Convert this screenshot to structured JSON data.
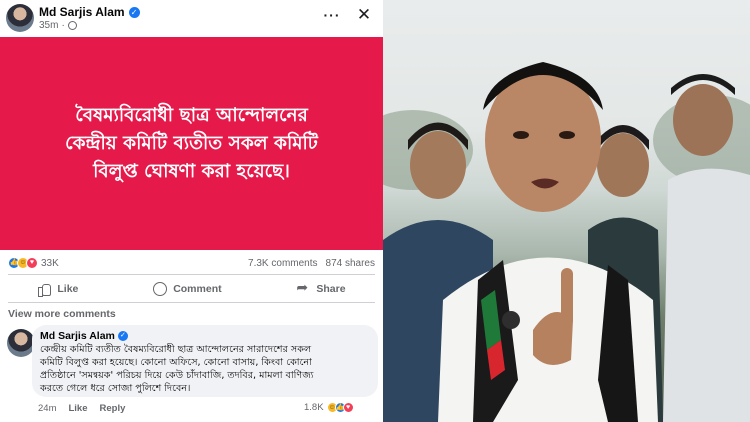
{
  "post": {
    "author": "Md Sarjis Alam",
    "time": "35m",
    "card_line1": "বৈষম্যবিরোধী ছাত্র আন্দোলনের",
    "card_line2": "কেন্দ্রীয় কমিটি ব্যতীত সকল কমিটি",
    "card_line3": "বিলুপ্ত ঘোষণা করা হয়েছে।",
    "card_color": "#e5194a"
  },
  "stats": {
    "reactions": "33K",
    "comments": "7.3K comments",
    "shares": "874 shares"
  },
  "actions": {
    "like": "Like",
    "comment": "Comment",
    "share": "Share"
  },
  "view_more": "View more comments",
  "comment": {
    "author": "Md Sarjis Alam",
    "line1": "কেন্দ্রীয় কমিটি ব্যতীত বৈষম্যবিরোধী ছাত্র আন্দোলনের সারাদেশের সকল",
    "line2": "কমিটি বিলুপ্ত করা হয়েছে। কোনো অফিসে, কোনো বাসায়, কিংবা কোনো",
    "line3": "প্রতিষ্ঠানে 'সমন্বয়ক' পরিচয় দিয়ে কেউ চাঁদাবাজি, তদবির, মামলা বাণিজ্য",
    "line4": "করতে গেলে ধরে সোজা পুলিশে দিবেন।",
    "time": "24m",
    "like": "Like",
    "reply": "Reply",
    "reactions": "1.8K"
  },
  "icons": {
    "verified": "verified-badge-icon",
    "more": "more-options-icon",
    "close": "close-icon"
  }
}
